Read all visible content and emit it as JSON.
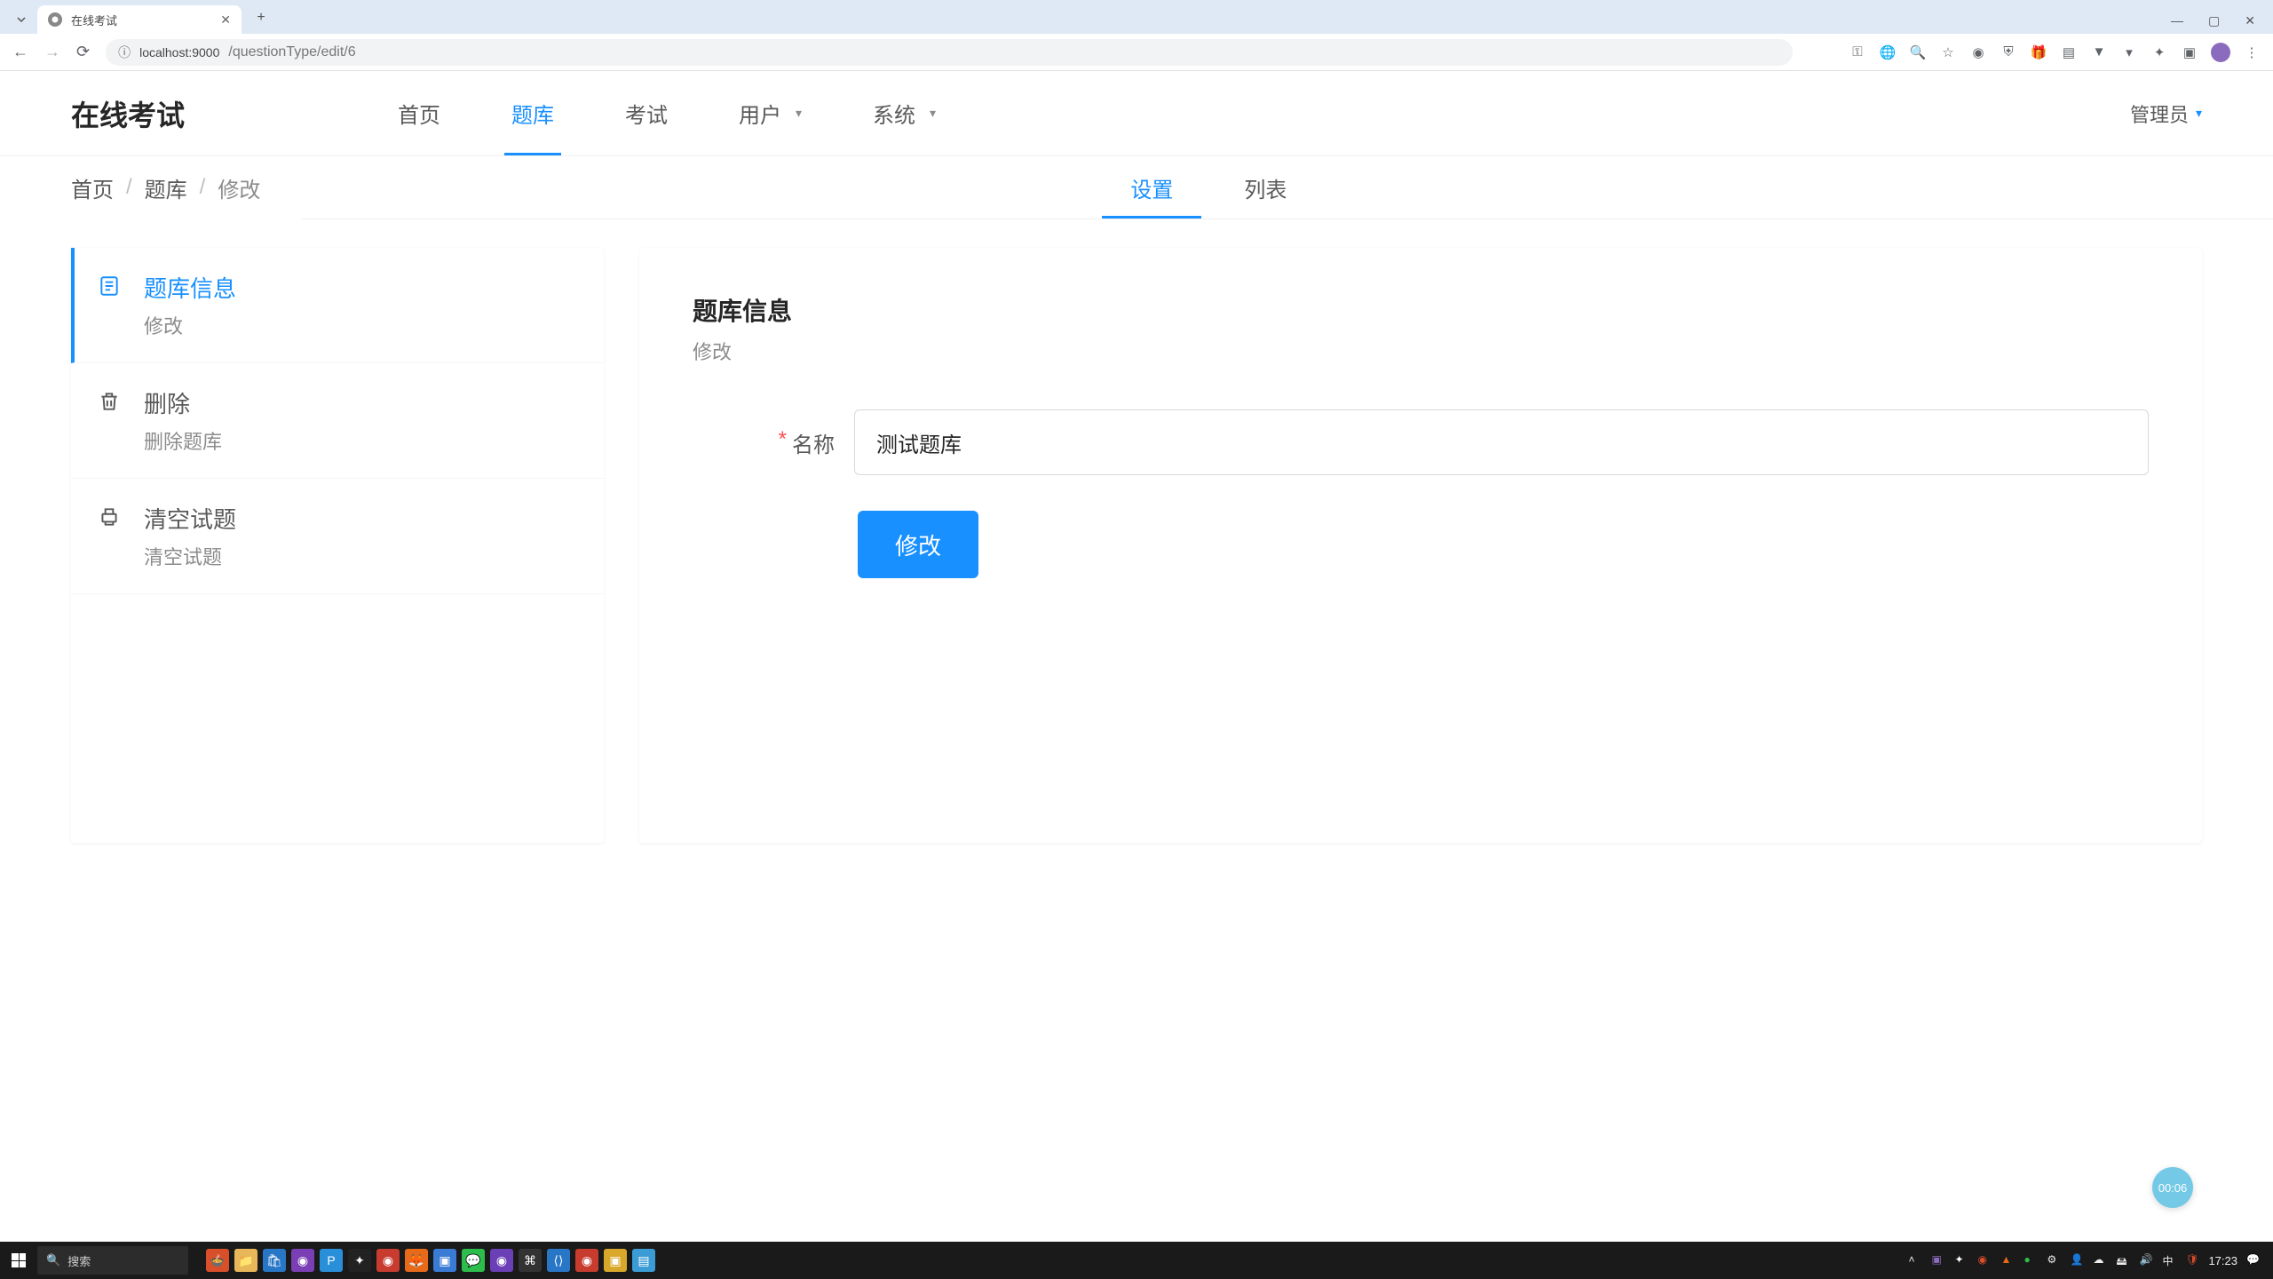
{
  "browser": {
    "tab_title": "在线考试",
    "url_host": "localhost:9000",
    "url_path": "/questionType/edit/6",
    "window_controls": {
      "min": "—",
      "max": "▢",
      "close": "✕"
    }
  },
  "header": {
    "logo": "在线考试",
    "nav": [
      {
        "label": "首页",
        "active": false,
        "has_chev": false
      },
      {
        "label": "题库",
        "active": true,
        "has_chev": false
      },
      {
        "label": "考试",
        "active": false,
        "has_chev": false
      },
      {
        "label": "用户",
        "active": false,
        "has_chev": true
      },
      {
        "label": "系统",
        "active": false,
        "has_chev": true
      }
    ],
    "user_label": "管理员"
  },
  "breadcrumb": [
    "首页",
    "题库",
    "修改"
  ],
  "subtabs": [
    {
      "label": "设置",
      "active": true
    },
    {
      "label": "列表",
      "active": false
    }
  ],
  "sidebar": [
    {
      "icon": "file",
      "title": "题库信息",
      "desc": "修改",
      "active": true
    },
    {
      "icon": "trash",
      "title": "删除",
      "desc": "删除题库",
      "active": false
    },
    {
      "icon": "printer",
      "title": "清空试题",
      "desc": "清空试题",
      "active": false
    }
  ],
  "panel": {
    "title": "题库信息",
    "subtitle": "修改",
    "name_label": "名称",
    "name_value": "测试题库",
    "submit_label": "修改"
  },
  "floating_badge": "00:06",
  "taskbar": {
    "search_placeholder": "搜索",
    "clock": "17:23"
  }
}
